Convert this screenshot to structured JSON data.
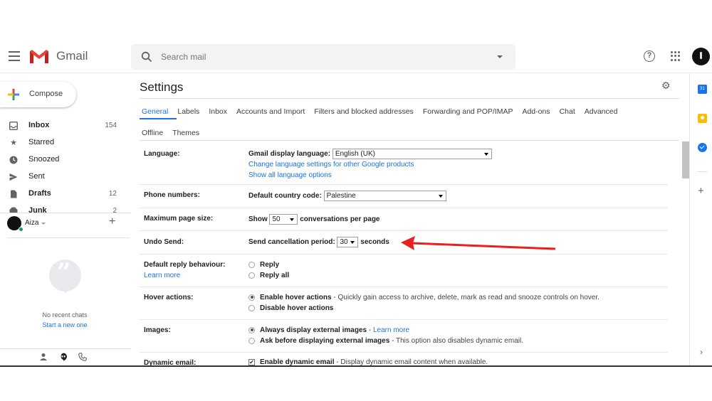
{
  "app": {
    "name": "Gmail"
  },
  "search": {
    "placeholder": "Search mail"
  },
  "compose": {
    "label": "Compose"
  },
  "sidebar": {
    "items": [
      {
        "label": "Inbox",
        "count": "154",
        "bold": true,
        "icon": "inbox-icon"
      },
      {
        "label": "Starred",
        "count": "",
        "bold": false,
        "icon": "star-icon"
      },
      {
        "label": "Snoozed",
        "count": "",
        "bold": false,
        "icon": "clock-icon"
      },
      {
        "label": "Sent",
        "count": "",
        "bold": false,
        "icon": "send-icon"
      },
      {
        "label": "Drafts",
        "count": "12",
        "bold": true,
        "icon": "draft-icon"
      },
      {
        "label": "Junk",
        "count": "2",
        "bold": true,
        "icon": "junk-icon"
      }
    ]
  },
  "chat": {
    "user_name": "Aiza",
    "no_chats": "No recent chats",
    "start_new": "Start a new one"
  },
  "settings": {
    "title": "Settings",
    "tabs_row1": [
      "General",
      "Labels",
      "Inbox",
      "Accounts and Import",
      "Filters and blocked addresses",
      "Forwarding and POP/IMAP",
      "Add-ons",
      "Chat",
      "Advanced"
    ],
    "tabs_row2": [
      "Offline",
      "Themes"
    ],
    "active_tab": "General",
    "language": {
      "label": "Language:",
      "display_label": "Gmail display language:",
      "value": "English (UK)",
      "link1": "Change language settings for other Google products",
      "link2": "Show all language options"
    },
    "phone": {
      "label": "Phone numbers:",
      "country_label": "Default country code:",
      "value": "Palestine"
    },
    "page_size": {
      "label": "Maximum page size:",
      "show": "Show",
      "value": "50",
      "suffix": "conversations per page"
    },
    "undo_send": {
      "label": "Undo Send:",
      "period_label": "Send cancellation period:",
      "value": "30",
      "unit": "seconds"
    },
    "reply": {
      "label": "Default reply behaviour:",
      "learn_more": "Learn more",
      "options": [
        "Reply",
        "Reply all"
      ],
      "selected": "Reply"
    },
    "hover": {
      "label": "Hover actions:",
      "enable": "Enable hover actions",
      "enable_desc": " - Quickly gain access to archive, delete, mark as read and snooze controls on hover.",
      "disable": "Disable hover actions",
      "selected": "enable"
    },
    "images": {
      "label": "Images:",
      "always": "Always display external images",
      "always_sep": " - ",
      "learn_more": "Learn more",
      "ask": "Ask before displaying external images",
      "ask_desc": " - This option also disables dynamic email.",
      "selected": "always"
    },
    "dynamic": {
      "label": "Dynamic email:",
      "enable": "Enable dynamic email",
      "enable_desc": " - Display dynamic email content when available.",
      "checked": true
    }
  },
  "right_panel": {
    "calendar_day": "31"
  },
  "colors": {
    "accent": "#1a73e8",
    "annotation": "#e8201f"
  }
}
